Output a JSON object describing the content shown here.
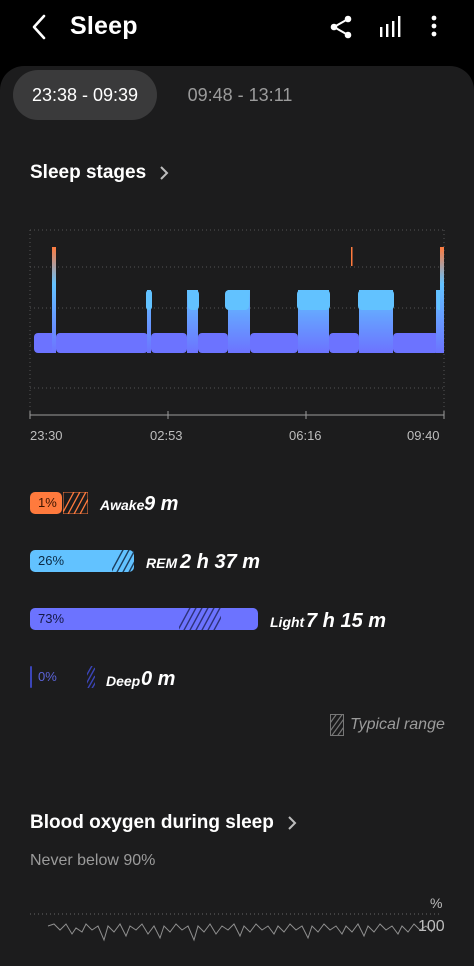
{
  "app": {
    "title": "Sleep",
    "actions": [
      "share-icon",
      "stats-icon",
      "more-icon"
    ]
  },
  "tabs": [
    {
      "label": "23:38 - 09:39",
      "selected": true
    },
    {
      "label": "09:48 - 13:11",
      "selected": false
    }
  ],
  "sleep_stages": {
    "title": "Sleep stages",
    "x_ticks": [
      "23:30",
      "02:53",
      "06:16",
      "09:40"
    ],
    "colors": {
      "awake": "#ff7a3d",
      "rem": "#62c2ff",
      "light": "#6c73ff",
      "deep": "#3b45b8"
    },
    "stages": [
      {
        "key": "awake",
        "name": "Awake",
        "percent_label": "1%",
        "duration": "9 m",
        "percent": 1
      },
      {
        "key": "rem",
        "name": "REM",
        "percent_label": "26%",
        "duration": "2 h 37 m",
        "percent": 26
      },
      {
        "key": "light",
        "name": "Light",
        "percent_label": "73%",
        "duration": "7 h 15 m",
        "percent": 73
      },
      {
        "key": "deep",
        "name": "Deep",
        "percent_label": "0%",
        "duration": "0 m",
        "percent": 0
      }
    ],
    "legend_label": "Typical range"
  },
  "blood_oxygen": {
    "title": "Blood oxygen during sleep",
    "subtitle": "Never below 90%",
    "unit": "%",
    "top_label": "100"
  }
}
